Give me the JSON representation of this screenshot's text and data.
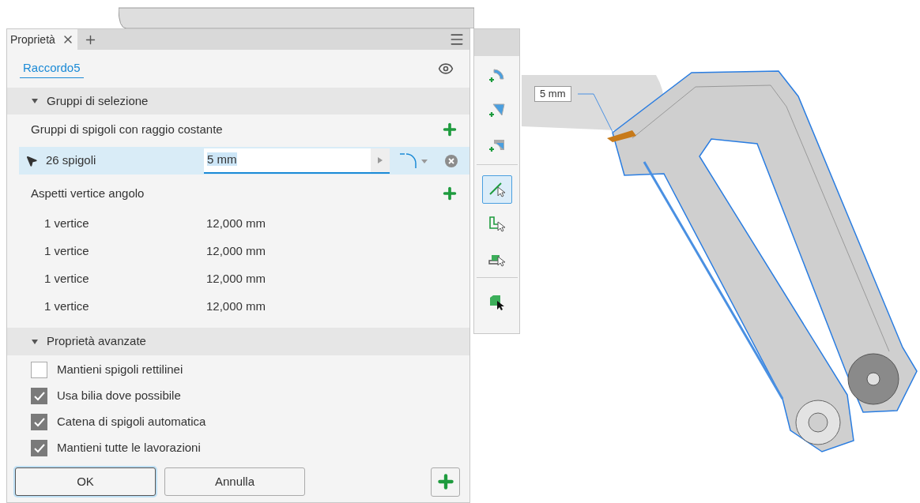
{
  "panel": {
    "tab": {
      "label": "Proprietà",
      "selected": true
    },
    "feature_name": "Raccordo5",
    "selection_section": {
      "title": "Gruppi di selezione",
      "expanded": true,
      "constant_radius_label": "Gruppi di spigoli con raggio costante",
      "edge_set": {
        "label": "26 spigoli",
        "value": "5 mm",
        "selected": true
      },
      "corner_label": "Aspetti vertice angolo",
      "corner_rows": [
        {
          "label": "1 vertice",
          "value": "12,000 mm"
        },
        {
          "label": "1 vertice",
          "value": "12,000 mm"
        },
        {
          "label": "1 vertice",
          "value": "12,000 mm"
        },
        {
          "label": "1 vertice",
          "value": "12,000 mm"
        }
      ]
    },
    "advanced_section": {
      "title": "Proprietà avanzate",
      "expanded": true,
      "options": [
        {
          "label": "Mantieni spigoli rettilinei",
          "checked": false
        },
        {
          "label": "Usa bilia dove possibile",
          "checked": true
        },
        {
          "label": "Catena di spigoli automatica",
          "checked": true
        },
        {
          "label": "Mantieni tutte le lavorazioni",
          "checked": true
        }
      ]
    },
    "buttons": [
      {
        "label": "OK",
        "kind": "primary"
      },
      {
        "label": "Annulla",
        "kind": "secondary"
      }
    ]
  },
  "toolbar": {
    "tools": [
      {
        "kind": "add-constant",
        "selected": false
      },
      {
        "kind": "add-variable",
        "selected": false
      },
      {
        "kind": "add-setback",
        "selected": false
      },
      {
        "kind": "edge",
        "selected": true
      },
      {
        "kind": "loop",
        "selected": false
      },
      {
        "kind": "feature",
        "selected": false
      },
      {
        "kind": "solid",
        "selected": false
      }
    ]
  },
  "viewport": {
    "dimension_label": "5 mm"
  }
}
